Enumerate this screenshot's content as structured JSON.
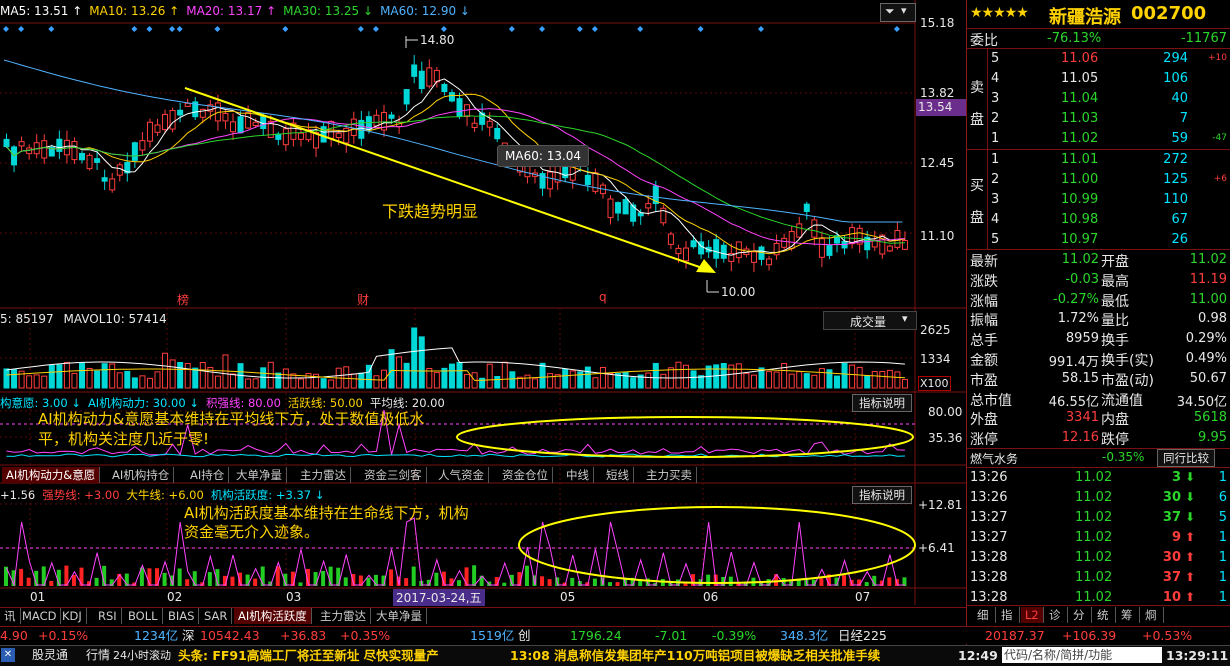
{
  "main_chart": {
    "ma_legend": [
      {
        "label": "MA5: 13.51",
        "arrow": "↑",
        "color": "#ffffff"
      },
      {
        "label": "MA10: 13.26",
        "arrow": "↑",
        "color": "#ffd200"
      },
      {
        "label": "MA20: 13.17",
        "arrow": "↑",
        "color": "#ff44ff"
      },
      {
        "label": "MA30: 13.25",
        "arrow": "↓",
        "color": "#2bd62b"
      },
      {
        "label": "MA60: 12.90",
        "arrow": "↓",
        "color": "#4fb3ff"
      }
    ],
    "price_axis": [
      "15.18",
      "13.82",
      "13.54",
      "12.45",
      "11.10"
    ],
    "high_label": "14.80",
    "low_label": "10.00",
    "tooltip": "MA60: 13.04",
    "annotation": "下跌趋势明显",
    "markers": [
      "榜",
      "财",
      "q"
    ],
    "trend_arrow_color": "#ffff00"
  },
  "volume_panel": {
    "legend_prefix": "5: 85197",
    "mavol10": "MAVOL10: 57414",
    "dropdown": "成交量",
    "axis": [
      "2625",
      "1334",
      "X100"
    ]
  },
  "ai_panel1": {
    "legend": [
      {
        "label": "构意愿: 3.00",
        "arrow": "↓",
        "color": "#00e5ff"
      },
      {
        "label": "AI机构动力: 30.00",
        "arrow": "↓",
        "color": "#00e5ff"
      },
      {
        "label": "积强线: 80.00",
        "color": "#ff44ff"
      },
      {
        "label": "活跃线: 50.00",
        "color": "#ffd200"
      },
      {
        "label": "平均线: 20.00",
        "color": "#e8e8e8"
      }
    ],
    "button": "指标说明",
    "axis": [
      "80.00",
      "35.36"
    ],
    "annotation_line1": "AI机构动力&意愿基本维持在平均线下方，处于数值极低水",
    "annotation_line2": "平，机构关注度几近于零!"
  },
  "indicator_tabs": [
    "AI机构动力&意愿",
    "AI机构持仓",
    "AI持仓",
    "大单净量",
    "主力雷达",
    "资金三剑客",
    "人气资金",
    "资金仓位",
    "中线",
    "短线",
    "主力买卖"
  ],
  "ai_panel2": {
    "legend": [
      {
        "label": "+1.56",
        "color": "#e8e8e8"
      },
      {
        "label": "强势线: +3.00",
        "color": "#ff3d3d"
      },
      {
        "label": "大牛线: +6.00",
        "color": "#ffd200"
      },
      {
        "label": "机构活跃度: +3.37",
        "arrow": "↓",
        "color": "#00e5ff"
      }
    ],
    "button": "指标说明",
    "axis": [
      "+12.81",
      "+6.41"
    ],
    "annotation_line1": "AI机构活跃度基本维持在生命线下方，机构",
    "annotation_line2": "资金毫无介入迹象。"
  },
  "time_axis": {
    "labels": [
      "01",
      "02",
      "03",
      "05",
      "06",
      "07"
    ],
    "highlight": "2017-03-24,五"
  },
  "bottom_tabs": [
    "讯",
    "MACD",
    "KDJ",
    "RSI",
    "BOLL",
    "BIAS",
    "SAR",
    "AI机构活跃度",
    "主力雷达",
    "大单净量"
  ],
  "quote": {
    "stars": "★★★★★",
    "name": "新疆浩源",
    "code": "002700",
    "weibi_label": "委比",
    "weibi_value": "-76.13%",
    "weibi_diff": "-11767",
    "sell_label": [
      "卖",
      "盘"
    ],
    "buy_label": [
      "买",
      "盘"
    ],
    "sell": [
      {
        "lvl": "5",
        "price": "11.06",
        "vol": "294",
        "chg": "+10"
      },
      {
        "lvl": "4",
        "price": "11.05",
        "vol": "106",
        "chg": ""
      },
      {
        "lvl": "3",
        "price": "11.04",
        "vol": "40",
        "chg": ""
      },
      {
        "lvl": "2",
        "price": "11.03",
        "vol": "7",
        "chg": ""
      },
      {
        "lvl": "1",
        "price": "11.02",
        "vol": "59",
        "chg": "-47"
      }
    ],
    "buy": [
      {
        "lvl": "1",
        "price": "11.01",
        "vol": "272",
        "chg": ""
      },
      {
        "lvl": "2",
        "price": "11.00",
        "vol": "125",
        "chg": "+6"
      },
      {
        "lvl": "3",
        "price": "10.99",
        "vol": "110",
        "chg": ""
      },
      {
        "lvl": "4",
        "price": "10.98",
        "vol": "67",
        "chg": ""
      },
      {
        "lvl": "5",
        "price": "10.97",
        "vol": "26",
        "chg": ""
      }
    ],
    "stats": [
      {
        "l1": "最新",
        "v1": "11.02",
        "c1": "dn",
        "l2": "开盘",
        "v2": "11.02",
        "c2": "dn"
      },
      {
        "l1": "涨跌",
        "v1": "-0.03",
        "c1": "dn",
        "l2": "最高",
        "v2": "11.19",
        "c2": "up"
      },
      {
        "l1": "涨幅",
        "v1": "-0.27%",
        "c1": "dn",
        "l2": "最低",
        "v2": "11.00",
        "c2": "dn"
      },
      {
        "l1": "振幅",
        "v1": "1.72%",
        "c1": "wht",
        "l2": "量比",
        "v2": "0.98",
        "c2": "wht"
      },
      {
        "l1": "总手",
        "v1": "8959",
        "c1": "wht",
        "l2": "换手",
        "v2": "0.29%",
        "c2": "wht"
      },
      {
        "l1": "金额",
        "v1": "991.4万",
        "c1": "wht",
        "l2": "换手(实)",
        "v2": "0.49%",
        "c2": "wht"
      },
      {
        "l1": "市盈",
        "v1": "58.15",
        "c1": "wht",
        "l2": "市盈(动)",
        "v2": "50.67",
        "c2": "wht"
      },
      {
        "l1": "总市值",
        "v1": "46.55亿",
        "c1": "wht",
        "l2": "流通值",
        "v2": "34.50亿",
        "c2": "wht"
      },
      {
        "l1": "外盘",
        "v1": "3341",
        "c1": "up",
        "l2": "内盘",
        "v2": "5618",
        "c2": "dn"
      },
      {
        "l1": "涨停",
        "v1": "12.16",
        "c1": "up",
        "l2": "跌停",
        "v2": "9.95",
        "c2": "dn"
      }
    ],
    "sector_label": "燃气水务",
    "sector_value": "-0.35%",
    "sector_btn": "同行比较",
    "ticks": [
      {
        "time": "13:26",
        "price": "11.02",
        "vol": "3",
        "dir": "down",
        "n": "1"
      },
      {
        "time": "13:26",
        "price": "11.02",
        "vol": "30",
        "dir": "down",
        "n": "6"
      },
      {
        "time": "13:27",
        "price": "11.02",
        "vol": "37",
        "dir": "down",
        "n": "5"
      },
      {
        "time": "13:27",
        "price": "11.02",
        "vol": "9",
        "dir": "up",
        "n": "1"
      },
      {
        "time": "13:28",
        "price": "11.02",
        "vol": "30",
        "dir": "up",
        "n": "1"
      },
      {
        "time": "13:28",
        "price": "11.02",
        "vol": "37",
        "dir": "up",
        "n": "1"
      },
      {
        "time": "13:28",
        "price": "11.02",
        "vol": "10",
        "dir": "up",
        "n": "1"
      }
    ],
    "side_tabs": [
      "细",
      "指",
      "L2",
      "诊",
      "分",
      "统",
      "筹",
      "烱"
    ]
  },
  "index_bar": [
    {
      "t": "4.90",
      "c": "up"
    },
    {
      "t": "+0.15%",
      "c": "up"
    },
    {
      "t": "1234亿",
      "c": "blue"
    },
    {
      "t": "深",
      "c": "wht"
    },
    {
      "t": "10542.43",
      "c": "up"
    },
    {
      "t": "+36.83",
      "c": "up"
    },
    {
      "t": "+0.35%",
      "c": "up"
    },
    {
      "t": "1519亿",
      "c": "blue"
    },
    {
      "t": "创",
      "c": "wht"
    },
    {
      "t": "1796.24",
      "c": "dn"
    },
    {
      "t": "-7.01",
      "c": "dn"
    },
    {
      "t": "-0.39%",
      "c": "dn"
    },
    {
      "t": "348.3亿",
      "c": "blue"
    },
    {
      "t": "日经225",
      "c": "wht"
    },
    {
      "t": "20187.37",
      "c": "up"
    },
    {
      "t": "+106.39",
      "c": "up"
    },
    {
      "t": "+0.53%",
      "c": "up"
    }
  ],
  "status_bar": {
    "left": [
      "股灵通",
      "行情",
      "24小时滚动"
    ],
    "news1": "头条: FF91高端工厂将迁至新址 尽快实现量产",
    "news2": "13:08 消息称信发集团年产110万吨铝项目被爆缺乏相关批准手续",
    "time1": "12:49",
    "search": "代码/名称/简拼/功能",
    "time2": "13:29:11"
  }
}
